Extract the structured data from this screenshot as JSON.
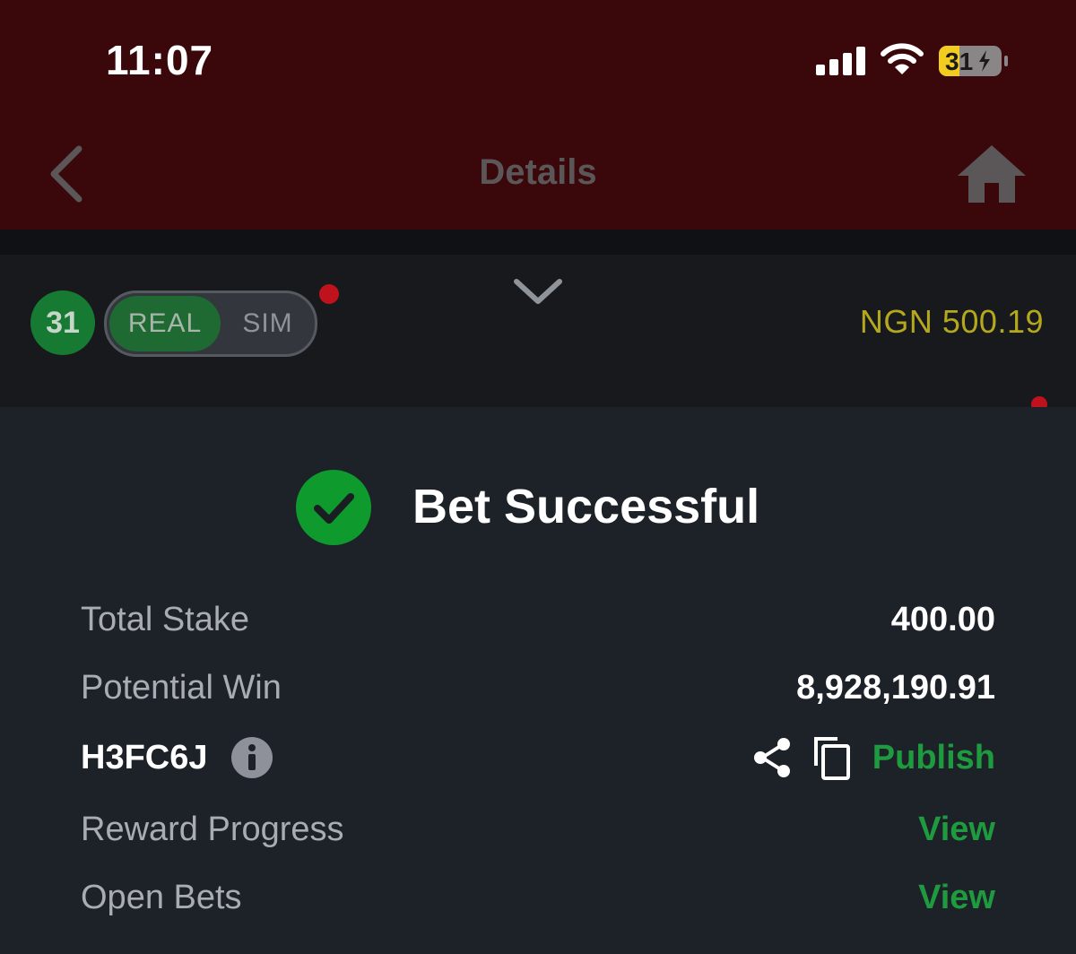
{
  "status_bar": {
    "time": "11:07",
    "battery": "31"
  },
  "header": {
    "title": "Details"
  },
  "account": {
    "level": "31",
    "mode_real": "REAL",
    "mode_sim": "SIM",
    "balance": "NGN 500.19"
  },
  "bet_result": {
    "title": "Bet Successful",
    "rows": {
      "total_stake": {
        "label": "Total Stake",
        "value": "400.00"
      },
      "potential_win": {
        "label": "Potential Win",
        "value": "8,928,190.91"
      },
      "booking_code": {
        "code": "H3FC6J",
        "publish_label": "Publish"
      },
      "reward_progress": {
        "label": "Reward Progress",
        "link": "View"
      },
      "open_bets": {
        "label": "Open Bets",
        "link": "View"
      }
    }
  },
  "colors": {
    "header_bg": "#3a070a",
    "sheet_bg": "#1d2128",
    "accent_green": "#1f9b3f",
    "balance_yellow": "#b4a81d",
    "alert_red": "#c0121c"
  },
  "icons": [
    "signal-icon",
    "wifi-icon",
    "battery-icon",
    "back-icon",
    "home-icon",
    "chevron-down-icon",
    "check-circle-icon",
    "info-icon",
    "share-icon",
    "copy-icon"
  ]
}
